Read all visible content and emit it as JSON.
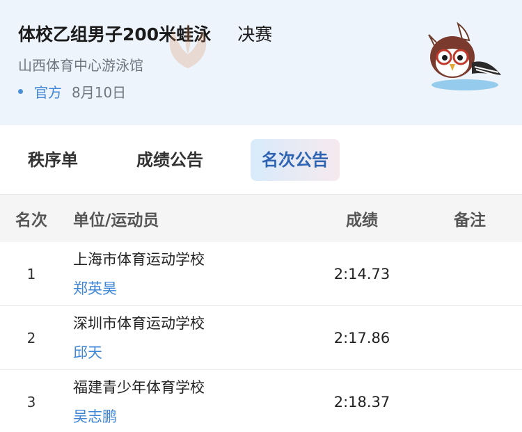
{
  "header": {
    "event_title": "体校乙组男子200米蛙泳",
    "stage": "决赛",
    "venue": "山西体育中心游泳馆",
    "source": "官方",
    "date": "8月10日"
  },
  "tabs": [
    {
      "label": "秩序单",
      "active": false
    },
    {
      "label": "成绩公告",
      "active": false
    },
    {
      "label": "名次公告",
      "active": true
    }
  ],
  "table": {
    "columns": {
      "rank": "名次",
      "unit": "单位/运动员",
      "score": "成绩",
      "note": "备注"
    },
    "rows": [
      {
        "rank": "1",
        "unit": "上海市体育运动学校",
        "athlete": "郑英昊",
        "score": "2:14.73",
        "note": ""
      },
      {
        "rank": "2",
        "unit": "深圳市体育运动学校",
        "athlete": "邱天",
        "score": "2:17.86",
        "note": ""
      },
      {
        "rank": "3",
        "unit": "福建青少年体育学校",
        "athlete": "吴志鹏",
        "score": "2:18.37",
        "note": ""
      }
    ]
  },
  "colors": {
    "accent": "#3f86d8",
    "header_bg": "#eef4fb",
    "active_tab_text": "#2f64b3"
  },
  "icons": {
    "watermark": "games-emblem-watermark",
    "mascot": "mascot-bird-icon"
  }
}
